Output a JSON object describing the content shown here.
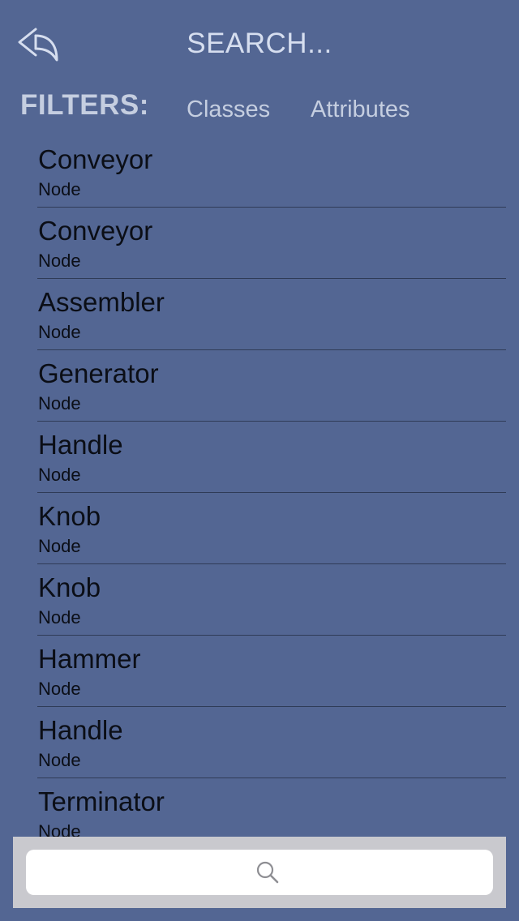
{
  "header": {
    "title": "SEARCH...",
    "back_icon": "reply-arrow-icon"
  },
  "filters": {
    "label": "FILTERS:",
    "tabs": [
      {
        "label": "Classes"
      },
      {
        "label": "Attributes"
      }
    ]
  },
  "results": [
    {
      "name": "Conveyor",
      "type": "Node"
    },
    {
      "name": "Conveyor",
      "type": "Node"
    },
    {
      "name": "Assembler",
      "type": "Node"
    },
    {
      "name": "Generator",
      "type": "Node"
    },
    {
      "name": "Handle",
      "type": "Node"
    },
    {
      "name": "Knob",
      "type": "Node"
    },
    {
      "name": "Knob",
      "type": "Node"
    },
    {
      "name": "Hammer",
      "type": "Node"
    },
    {
      "name": "Handle",
      "type": "Node"
    },
    {
      "name": "Terminator",
      "type": "Node"
    }
  ],
  "search": {
    "placeholder": "",
    "icon": "search-icon"
  },
  "colors": {
    "background": "#536693",
    "header_text": "#d6deef",
    "filter_text": "#c5cee0",
    "item_text": "#0b0e16",
    "divider": "#2f3b57",
    "search_bar_bg": "#c9c9ce",
    "search_field_bg": "#ffffff"
  }
}
